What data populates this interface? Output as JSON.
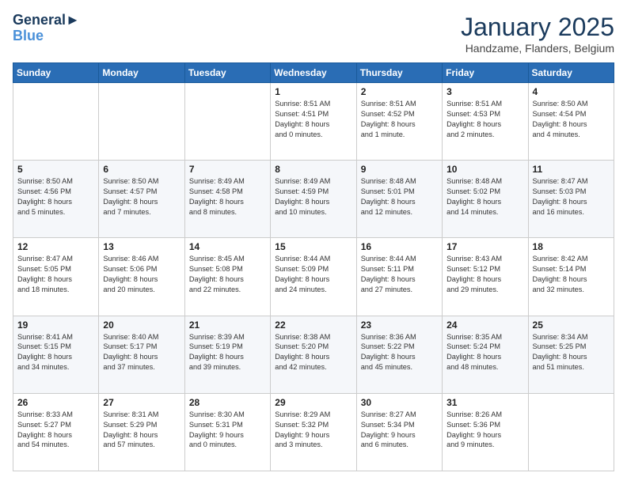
{
  "header": {
    "logo_line1": "General",
    "logo_line2": "Blue",
    "month_title": "January 2025",
    "subtitle": "Handzame, Flanders, Belgium"
  },
  "days_of_week": [
    "Sunday",
    "Monday",
    "Tuesday",
    "Wednesday",
    "Thursday",
    "Friday",
    "Saturday"
  ],
  "weeks": [
    [
      {
        "day": "",
        "content": ""
      },
      {
        "day": "",
        "content": ""
      },
      {
        "day": "",
        "content": ""
      },
      {
        "day": "1",
        "content": "Sunrise: 8:51 AM\nSunset: 4:51 PM\nDaylight: 8 hours\nand 0 minutes."
      },
      {
        "day": "2",
        "content": "Sunrise: 8:51 AM\nSunset: 4:52 PM\nDaylight: 8 hours\nand 1 minute."
      },
      {
        "day": "3",
        "content": "Sunrise: 8:51 AM\nSunset: 4:53 PM\nDaylight: 8 hours\nand 2 minutes."
      },
      {
        "day": "4",
        "content": "Sunrise: 8:50 AM\nSunset: 4:54 PM\nDaylight: 8 hours\nand 4 minutes."
      }
    ],
    [
      {
        "day": "5",
        "content": "Sunrise: 8:50 AM\nSunset: 4:56 PM\nDaylight: 8 hours\nand 5 minutes."
      },
      {
        "day": "6",
        "content": "Sunrise: 8:50 AM\nSunset: 4:57 PM\nDaylight: 8 hours\nand 7 minutes."
      },
      {
        "day": "7",
        "content": "Sunrise: 8:49 AM\nSunset: 4:58 PM\nDaylight: 8 hours\nand 8 minutes."
      },
      {
        "day": "8",
        "content": "Sunrise: 8:49 AM\nSunset: 4:59 PM\nDaylight: 8 hours\nand 10 minutes."
      },
      {
        "day": "9",
        "content": "Sunrise: 8:48 AM\nSunset: 5:01 PM\nDaylight: 8 hours\nand 12 minutes."
      },
      {
        "day": "10",
        "content": "Sunrise: 8:48 AM\nSunset: 5:02 PM\nDaylight: 8 hours\nand 14 minutes."
      },
      {
        "day": "11",
        "content": "Sunrise: 8:47 AM\nSunset: 5:03 PM\nDaylight: 8 hours\nand 16 minutes."
      }
    ],
    [
      {
        "day": "12",
        "content": "Sunrise: 8:47 AM\nSunset: 5:05 PM\nDaylight: 8 hours\nand 18 minutes."
      },
      {
        "day": "13",
        "content": "Sunrise: 8:46 AM\nSunset: 5:06 PM\nDaylight: 8 hours\nand 20 minutes."
      },
      {
        "day": "14",
        "content": "Sunrise: 8:45 AM\nSunset: 5:08 PM\nDaylight: 8 hours\nand 22 minutes."
      },
      {
        "day": "15",
        "content": "Sunrise: 8:44 AM\nSunset: 5:09 PM\nDaylight: 8 hours\nand 24 minutes."
      },
      {
        "day": "16",
        "content": "Sunrise: 8:44 AM\nSunset: 5:11 PM\nDaylight: 8 hours\nand 27 minutes."
      },
      {
        "day": "17",
        "content": "Sunrise: 8:43 AM\nSunset: 5:12 PM\nDaylight: 8 hours\nand 29 minutes."
      },
      {
        "day": "18",
        "content": "Sunrise: 8:42 AM\nSunset: 5:14 PM\nDaylight: 8 hours\nand 32 minutes."
      }
    ],
    [
      {
        "day": "19",
        "content": "Sunrise: 8:41 AM\nSunset: 5:15 PM\nDaylight: 8 hours\nand 34 minutes."
      },
      {
        "day": "20",
        "content": "Sunrise: 8:40 AM\nSunset: 5:17 PM\nDaylight: 8 hours\nand 37 minutes."
      },
      {
        "day": "21",
        "content": "Sunrise: 8:39 AM\nSunset: 5:19 PM\nDaylight: 8 hours\nand 39 minutes."
      },
      {
        "day": "22",
        "content": "Sunrise: 8:38 AM\nSunset: 5:20 PM\nDaylight: 8 hours\nand 42 minutes."
      },
      {
        "day": "23",
        "content": "Sunrise: 8:36 AM\nSunset: 5:22 PM\nDaylight: 8 hours\nand 45 minutes."
      },
      {
        "day": "24",
        "content": "Sunrise: 8:35 AM\nSunset: 5:24 PM\nDaylight: 8 hours\nand 48 minutes."
      },
      {
        "day": "25",
        "content": "Sunrise: 8:34 AM\nSunset: 5:25 PM\nDaylight: 8 hours\nand 51 minutes."
      }
    ],
    [
      {
        "day": "26",
        "content": "Sunrise: 8:33 AM\nSunset: 5:27 PM\nDaylight: 8 hours\nand 54 minutes."
      },
      {
        "day": "27",
        "content": "Sunrise: 8:31 AM\nSunset: 5:29 PM\nDaylight: 8 hours\nand 57 minutes."
      },
      {
        "day": "28",
        "content": "Sunrise: 8:30 AM\nSunset: 5:31 PM\nDaylight: 9 hours\nand 0 minutes."
      },
      {
        "day": "29",
        "content": "Sunrise: 8:29 AM\nSunset: 5:32 PM\nDaylight: 9 hours\nand 3 minutes."
      },
      {
        "day": "30",
        "content": "Sunrise: 8:27 AM\nSunset: 5:34 PM\nDaylight: 9 hours\nand 6 minutes."
      },
      {
        "day": "31",
        "content": "Sunrise: 8:26 AM\nSunset: 5:36 PM\nDaylight: 9 hours\nand 9 minutes."
      },
      {
        "day": "",
        "content": ""
      }
    ]
  ]
}
